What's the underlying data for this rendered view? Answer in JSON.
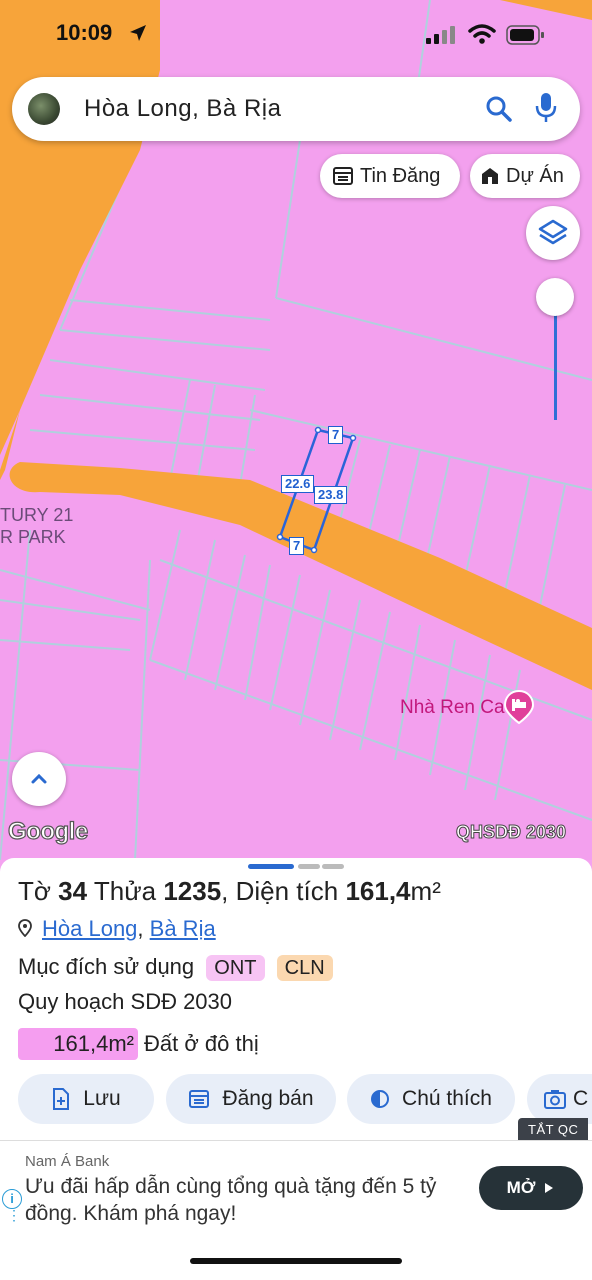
{
  "status_bar": {
    "time": "10:09"
  },
  "search": {
    "query": "Hòa Long, Bà Rịa"
  },
  "chips": {
    "listings": "Tin Đăng",
    "projects": "Dự Án"
  },
  "map": {
    "google_logo": "Google",
    "overlay_label": "QHSDĐ 2030",
    "edge_label_1": "TURY 21",
    "edge_label_2": "R PARK",
    "poi_name": "Nhà Ren Ca",
    "parcel_edges": {
      "top": "7",
      "bottom": "7",
      "left": "22.6",
      "right": "23.8"
    }
  },
  "parcel": {
    "sheet_label": "Tờ",
    "sheet_no": "34",
    "plot_label": "Thửa",
    "plot_no": "1235",
    "area_label": ", Diện tích",
    "area_value": "161,4",
    "area_unit": "m²",
    "ward": "Hòa Long",
    "city": "Bà Rịa",
    "purpose_label": "Mục đích sử dụng",
    "tag1": "ONT",
    "tag2": "CLN",
    "plan_label": "Quy hoạch SDĐ 2030",
    "legend_area": "161,4m²",
    "legend_text": "Đất ở đô thị"
  },
  "actions": {
    "save": "Lưu",
    "post": "Đăng bán",
    "legend": "Chú thích",
    "camera": "C"
  },
  "ad": {
    "close_label": "TẮT QC",
    "sponsor": "Nam Á Bank",
    "text": "Ưu đãi hấp dẫn cùng tổng quà tặng đến 5 tỷ đồng. Khám phá ngay!",
    "cta": "MỞ"
  },
  "colors": {
    "land": "#f3a0ee",
    "road": "#f7a43a",
    "accent": "#2a6ad0",
    "tag1_bg": "#f7c4f4",
    "tag2_bg": "#fbd8b0"
  }
}
